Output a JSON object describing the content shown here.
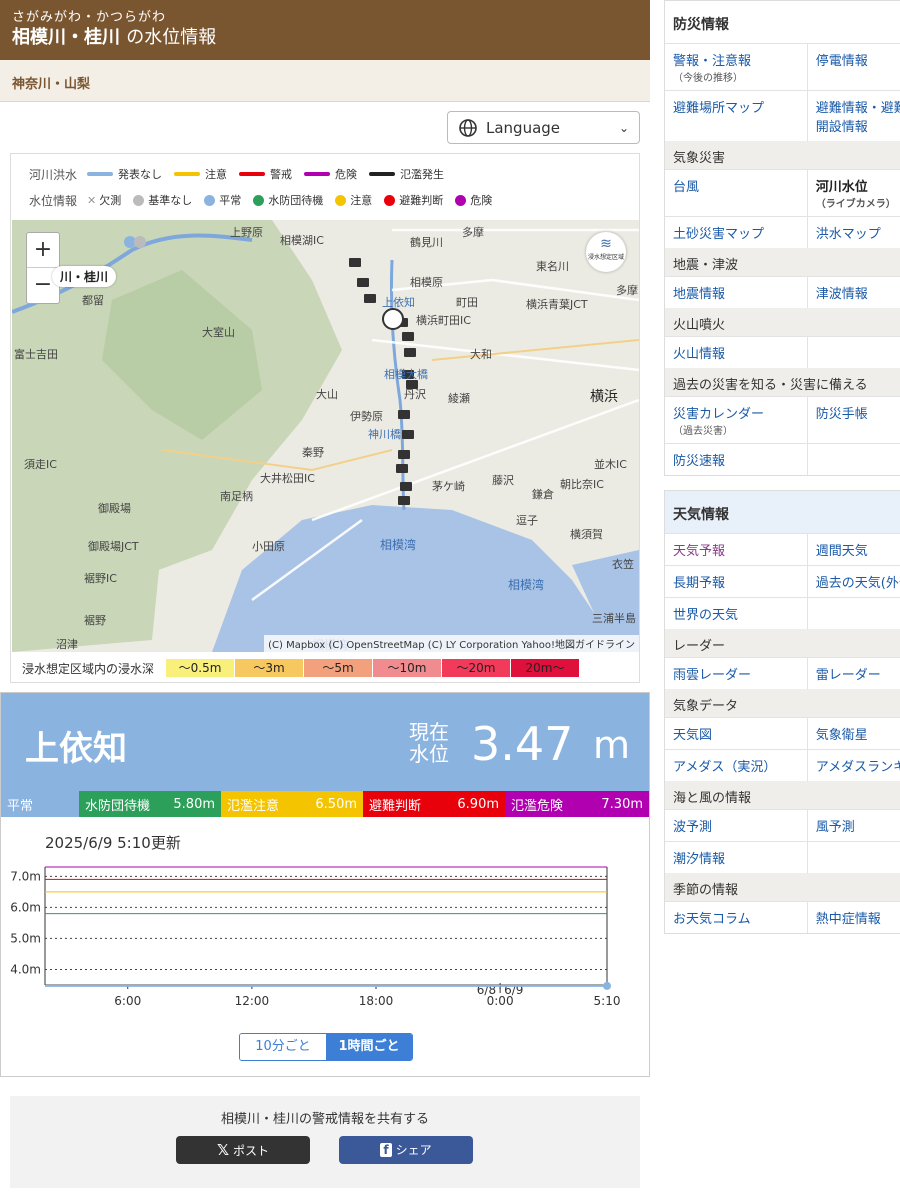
{
  "header": {
    "kana": "さがみがわ・かつらがわ",
    "title": "相模川・桂川",
    "title_suffix": "の水位情報",
    "region": "神奈川・山梨"
  },
  "language_select": {
    "label": "Language"
  },
  "legend": {
    "flood_label": "河川洪水",
    "flood_items": [
      {
        "label": "発表なし",
        "color": "#8ab3e0"
      },
      {
        "label": "注意",
        "color": "#f5c400"
      },
      {
        "label": "警戒",
        "color": "#e8000b"
      },
      {
        "label": "危険",
        "color": "#b000b0"
      },
      {
        "label": "氾濫発生",
        "color": "#222222"
      }
    ],
    "level_label": "水位情報",
    "level_items": [
      {
        "label": "欠測",
        "color": "#999999",
        "icon": "x-icon"
      },
      {
        "label": "基準なし",
        "color": "#bbbbbb"
      },
      {
        "label": "平常",
        "color": "#8ab3e0"
      },
      {
        "label": "水防団待機",
        "color": "#2ca05a"
      },
      {
        "label": "注意",
        "color": "#f5c400"
      },
      {
        "label": "避難判断",
        "color": "#e8000b"
      },
      {
        "label": "危険",
        "color": "#b000b0"
      }
    ]
  },
  "map": {
    "zoom_in": "+",
    "zoom_out": "−",
    "river_tag": "川・桂川",
    "shinsui_button": "浸水想定区域",
    "attribution": "(C) Mapbox (C) OpenStreetMap (C) LY Corporation Yahoo!地図ガイドライン",
    "labels": [
      "上野原",
      "相模湖IC",
      "多摩",
      "鶴見川",
      "東名川",
      "都留",
      "大室山",
      "相模原",
      "町田",
      "横浜青葉JCT",
      "多摩",
      "富士吉田",
      "横浜町田IC",
      "大和",
      "相模大橋",
      "丹沢",
      "大山",
      "綾瀬",
      "横浜",
      "伊勢原",
      "神川橋",
      "秦野",
      "須走IC",
      "大井松田IC",
      "南足柄",
      "茅ケ崎",
      "藤沢",
      "並木IC",
      "朝比奈IC",
      "御殿場",
      "鎌倉",
      "逗子",
      "御殿場JCT",
      "小田原",
      "横須賀",
      "裾野IC",
      "相模湾",
      "相模湾",
      "裾野",
      "三浦半島",
      "沼津",
      "衣笠",
      "上依知",
      "相模湾"
    ]
  },
  "depth_legend": {
    "label": "浸水想定区域内の浸水深",
    "items": [
      {
        "label": "〜0.5m",
        "color": "#f8f07a"
      },
      {
        "label": "〜3m",
        "color": "#f8c860"
      },
      {
        "label": "〜5m",
        "color": "#f3a07c"
      },
      {
        "label": "〜10m",
        "color": "#f08c90"
      },
      {
        "label": "〜20m",
        "color": "#f23a5a"
      },
      {
        "label": "20m〜",
        "color": "#e0103c"
      }
    ]
  },
  "station": {
    "name": "上依知",
    "current_label_1": "現在",
    "current_label_2": "水位",
    "current_value": "3.47",
    "unit": "m",
    "thresholds": [
      {
        "name": "平常",
        "value": "",
        "color": "#8ab3e0"
      },
      {
        "name": "水防団待機",
        "value": "5.80m",
        "color": "#2ca05a"
      },
      {
        "name": "氾濫注意",
        "value": "6.50m",
        "color": "#f5c400"
      },
      {
        "name": "避難判断",
        "value": "6.90m",
        "color": "#e8000b"
      },
      {
        "name": "氾濫危険",
        "value": "7.30m",
        "color": "#b000b0"
      }
    ],
    "updated": "2025/6/9 5:10更新",
    "toggle": {
      "ten_min": "10分ごと",
      "hourly": "1時間ごと"
    }
  },
  "chart_data": {
    "type": "line",
    "ylim": [
      3.5,
      7.3
    ],
    "yticks": [
      "7.0m",
      "6.0m",
      "5.0m",
      "4.0m"
    ],
    "xticks": [
      "6:00",
      "12:00",
      "18:00",
      "0:00",
      "5:10"
    ],
    "date_marks": [
      "6/8",
      "6/9"
    ],
    "thresholds": [
      {
        "value": 7.3,
        "color": "#b000b0"
      },
      {
        "value": 6.9,
        "color": "#e8000b"
      },
      {
        "value": 6.5,
        "color": "#f5c400"
      },
      {
        "value": 5.8,
        "color": "#2ca05a"
      }
    ],
    "series": [
      {
        "x": [
          "6/8 2:00",
          "6/8 6:00",
          "6/8 12:00",
          "6/8 18:00",
          "6/9 0:00",
          "6/9 5:10"
        ],
        "values": [
          3.47,
          3.47,
          3.47,
          3.47,
          3.47,
          3.47
        ]
      }
    ]
  },
  "share": {
    "title": "相模川・桂川の警戒情報を共有する",
    "x_label": "ポスト",
    "fb_label": "シェア"
  },
  "sidebar": {
    "disaster": {
      "heading": "防災情報",
      "rows": [
        [
          {
            "label": "警報・注意報",
            "sub": "（今後の推移）"
          },
          {
            "label": "停電情報"
          }
        ],
        [
          {
            "label": "避難場所マップ"
          },
          {
            "label": "避難情報・避難所",
            "label2": "開設情報"
          }
        ]
      ],
      "sections": [
        {
          "title": "気象災害",
          "rows": [
            [
              {
                "label": "台風"
              },
              {
                "label": "河川水位",
                "sub": "（ライブカメラ）",
                "active": true
              }
            ],
            [
              {
                "label": "土砂災害マップ"
              },
              {
                "label": "洪水マップ"
              }
            ]
          ]
        },
        {
          "title": "地震・津波",
          "rows": [
            [
              {
                "label": "地震情報"
              },
              {
                "label": "津波情報"
              }
            ]
          ]
        },
        {
          "title": "火山噴火",
          "rows": [
            [
              {
                "label": "火山情報"
              },
              {
                "label": ""
              }
            ]
          ]
        },
        {
          "title": "過去の災害を知る・災害に備える",
          "rows": [
            [
              {
                "label": "災害カレンダー",
                "sub": "（過去災害）"
              },
              {
                "label": "防災手帳"
              }
            ],
            [
              {
                "label": "防災速報"
              },
              {
                "label": ""
              }
            ]
          ]
        }
      ]
    },
    "weather": {
      "heading": "天気情報",
      "rows": [
        [
          {
            "label": "天気予報",
            "visited": true
          },
          {
            "label": "週間天気"
          }
        ],
        [
          {
            "label": "長期予報"
          },
          {
            "label": "過去の天気(外部)"
          }
        ],
        [
          {
            "label": "世界の天気"
          },
          {
            "label": ""
          }
        ]
      ],
      "sections": [
        {
          "title": "レーダー",
          "rows": [
            [
              {
                "label": "雨雲レーダー"
              },
              {
                "label": "雷レーダー"
              }
            ]
          ]
        },
        {
          "title": "気象データ",
          "rows": [
            [
              {
                "label": "天気図"
              },
              {
                "label": "気象衛星"
              }
            ],
            [
              {
                "label": "アメダス（実況）"
              },
              {
                "label": "アメダスランキング"
              }
            ]
          ]
        },
        {
          "title": "海と風の情報",
          "rows": [
            [
              {
                "label": "波予測"
              },
              {
                "label": "風予測"
              }
            ],
            [
              {
                "label": "潮汐情報"
              },
              {
                "label": ""
              }
            ]
          ]
        },
        {
          "title": "季節の情報",
          "rows": [
            [
              {
                "label": "お天気コラム"
              },
              {
                "label": "熱中症情報"
              }
            ]
          ]
        }
      ]
    }
  }
}
